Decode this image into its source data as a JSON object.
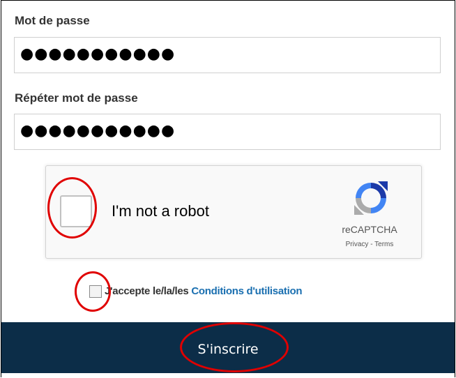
{
  "password": {
    "label": "Mot de passe",
    "value": "●●●●●●●●●●●"
  },
  "repeat_password": {
    "label": "Répéter mot de passe",
    "value": "●●●●●●●●●●●"
  },
  "captcha": {
    "label": "I'm not a robot",
    "brand": "reCAPTCHA",
    "privacy": "Privacy",
    "separator": " - ",
    "terms": "Terms"
  },
  "terms": {
    "prefix": "J'accepte le/la/les ",
    "link": "Conditions d'utilisation"
  },
  "submit_label": "S'inscrire",
  "colors": {
    "submit_bg": "#0c2d48",
    "link": "#1a6fb0",
    "annotation": "#e00000"
  }
}
